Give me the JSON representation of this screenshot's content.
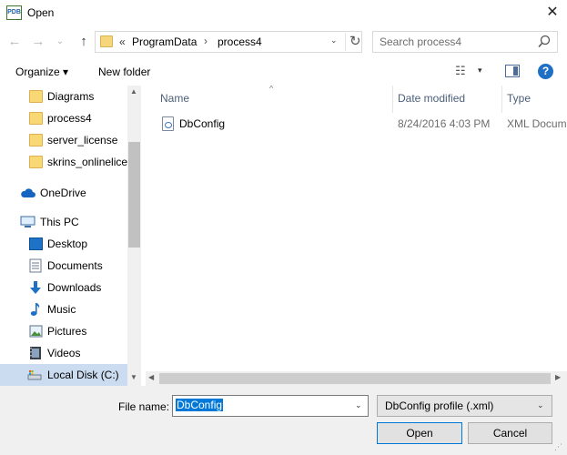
{
  "window": {
    "title": "Open",
    "app_icon_text": "PDB",
    "close_glyph": "✕"
  },
  "nav": {
    "back_glyph": "←",
    "forward_glyph": "→",
    "recent_glyph": "⌄",
    "up_glyph": "↑",
    "overflow": "«",
    "breadcrumbs": [
      "ProgramData",
      "process4"
    ],
    "separator": "›",
    "dropdown_glyph": "⌄",
    "refresh_glyph": "↻",
    "search_placeholder": "Search process4"
  },
  "toolbar": {
    "organize_label": "Organize ▾",
    "new_folder_label": "New folder",
    "view_glyph": "☷",
    "view_dropdown": "▾",
    "help_label": "?"
  },
  "sidebar": {
    "items": [
      {
        "label": "Diagrams",
        "icon": "folder-icon"
      },
      {
        "label": "process4",
        "icon": "folder-icon"
      },
      {
        "label": "server_license",
        "icon": "folder-icon"
      },
      {
        "label": "skrins_onlinelicense",
        "icon": "folder-icon"
      },
      {
        "label": "OneDrive",
        "icon": "cloud-icon"
      },
      {
        "label": "This PC",
        "icon": "computer-icon"
      },
      {
        "label": "Desktop",
        "icon": "desktop-icon"
      },
      {
        "label": "Documents",
        "icon": "documents-icon"
      },
      {
        "label": "Downloads",
        "icon": "download-icon"
      },
      {
        "label": "Music",
        "icon": "music-icon"
      },
      {
        "label": "Pictures",
        "icon": "pictures-icon"
      },
      {
        "label": "Videos",
        "icon": "videos-icon"
      },
      {
        "label": "Local Disk (C:)",
        "icon": "drive-icon"
      }
    ],
    "scroll_up": "▲",
    "scroll_down": "▼"
  },
  "file_list": {
    "columns": {
      "name": "Name",
      "date": "Date modified",
      "type": "Type"
    },
    "sort_glyph": "^",
    "rows": [
      {
        "name": "DbConfig",
        "date": "8/24/2016 4:03 PM",
        "type": "XML Document"
      }
    ],
    "scroll_left": "◀",
    "scroll_right": "▶"
  },
  "bottom": {
    "filename_label": "File name:",
    "filename_value": "DbConfig",
    "filename_dropdown": "⌄",
    "filetype_value": "DbConfig profile (.xml)",
    "filetype_arrow": "⌄",
    "open_label": "Open",
    "cancel_label": "Cancel",
    "grip": "⋰"
  },
  "colors": {
    "accent": "#0078d7",
    "selection": "#ccdcf0",
    "help": "#1f6fc5"
  }
}
